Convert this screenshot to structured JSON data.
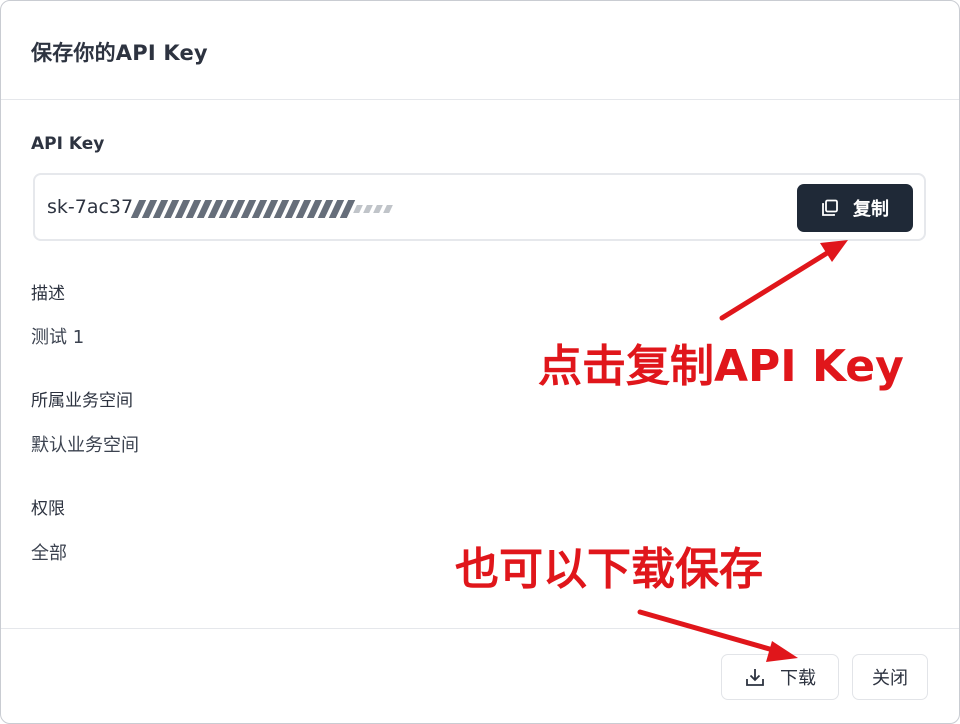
{
  "dialog": {
    "title": "保存你的API Key"
  },
  "api_key": {
    "label": "API Key",
    "value_prefix": "sk-7ac37",
    "copy_label": "复制"
  },
  "fields": {
    "description_label": "描述",
    "description_value": "测试 1",
    "workspace_label": "所属业务空间",
    "workspace_value": "默认业务空间",
    "permission_label": "权限",
    "permission_value": "全部"
  },
  "footer": {
    "download_label": "下载",
    "close_label": "关闭"
  },
  "annotations": {
    "copy_hint": "点击复制API Key",
    "download_hint": "也可以下载保存",
    "color": "#e0161b"
  },
  "icons": {
    "copy": "copy-icon",
    "download": "download-icon"
  },
  "colors": {
    "primary_button": "#1f2937",
    "border": "#e6e8ec",
    "text": "#2d3340"
  }
}
